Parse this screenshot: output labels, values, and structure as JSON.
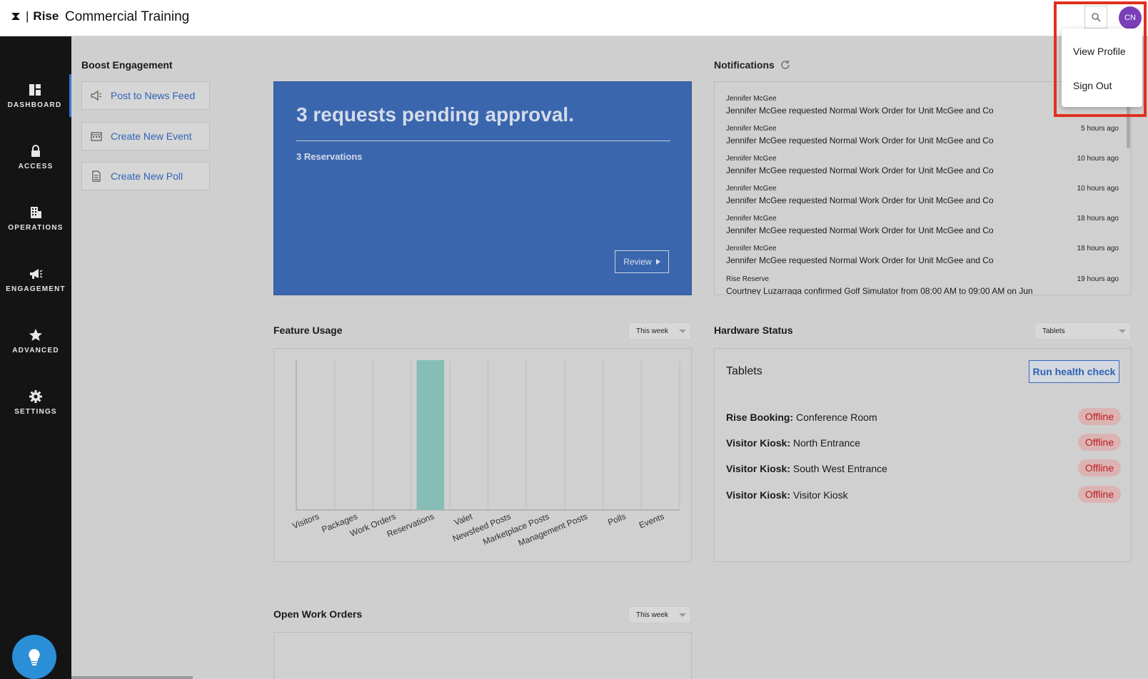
{
  "header": {
    "brand": "Rise",
    "title": "Commercial Training",
    "avatar_initials": "CN",
    "search_icon": "search-icon"
  },
  "sidebar": {
    "items": [
      {
        "label": "DASHBOARD",
        "icon": "dashboard-icon",
        "active": true
      },
      {
        "label": "ACCESS",
        "icon": "lock-icon",
        "active": false
      },
      {
        "label": "OPERATIONS",
        "icon": "building-icon",
        "active": false
      },
      {
        "label": "ENGAGEMENT",
        "icon": "megaphone-icon",
        "active": false
      },
      {
        "label": "ADVANCED",
        "icon": "star-icon",
        "active": false
      },
      {
        "label": "SETTINGS",
        "icon": "gear-icon",
        "active": false
      }
    ],
    "help_icon": "lightbulb-icon"
  },
  "boost": {
    "title": "Boost Engagement",
    "buttons": [
      {
        "label": "Post to News Feed",
        "icon": "megaphone-icon"
      },
      {
        "label": "Create New Event",
        "icon": "calendar-icon"
      },
      {
        "label": "Create New Poll",
        "icon": "document-icon"
      }
    ]
  },
  "pending": {
    "headline": "3 requests pending approval.",
    "subtitle": "3 Reservations",
    "review_label": "Review"
  },
  "notifications": {
    "title": "Notifications",
    "items": [
      {
        "who": "Jennifer McGee",
        "when": "",
        "message": "Jennifer McGee requested Normal Work Order for Unit McGee and Co"
      },
      {
        "who": "Jennifer McGee",
        "when": "5 hours ago",
        "message": "Jennifer McGee requested Normal Work Order for Unit McGee and Co"
      },
      {
        "who": "Jennifer McGee",
        "when": "10 hours ago",
        "message": "Jennifer McGee requested Normal Work Order for Unit McGee and Co"
      },
      {
        "who": "Jennifer McGee",
        "when": "10 hours ago",
        "message": "Jennifer McGee requested Normal Work Order for Unit McGee and Co"
      },
      {
        "who": "Jennifer McGee",
        "when": "18 hours ago",
        "message": "Jennifer McGee requested Normal Work Order for Unit McGee and Co"
      },
      {
        "who": "Jennifer McGee",
        "when": "18 hours ago",
        "message": "Jennifer McGee requested Normal Work Order for Unit McGee and Co"
      },
      {
        "who": "Rise Reserve",
        "when": "19 hours ago",
        "message": "Courtney Luzarraga confirmed Golf Simulator from 08:00 AM to 09:00 AM on Jun"
      }
    ]
  },
  "feature_usage": {
    "title": "Feature Usage",
    "range": "This week"
  },
  "chart_data": {
    "type": "bar",
    "categories": [
      "Visitors",
      "Packages",
      "Work Orders",
      "Reservations",
      "Valet",
      "Newsfeed Posts",
      "Marketplace Posts",
      "Management Posts",
      "Polls",
      "Events"
    ],
    "values": [
      0,
      0,
      0,
      3,
      0,
      0,
      0,
      0,
      0,
      0
    ],
    "ylim": [
      0,
      3
    ],
    "grid": true,
    "bar_color": "#86bdb6"
  },
  "hardware": {
    "title": "Hardware Status",
    "filter": "Tablets",
    "panel_title": "Tablets",
    "health_check_label": "Run health check",
    "devices": [
      {
        "type": "Rise Booking:",
        "name": "Conference Room",
        "status": "Offline"
      },
      {
        "type": "Visitor Kiosk:",
        "name": "North Entrance",
        "status": "Offline"
      },
      {
        "type": "Visitor Kiosk:",
        "name": "South West Entrance",
        "status": "Offline"
      },
      {
        "type": "Visitor Kiosk:",
        "name": "Visitor Kiosk",
        "status": "Offline"
      }
    ]
  },
  "open_work_orders": {
    "title": "Open Work Orders",
    "range": "This week"
  },
  "profile_menu": {
    "items": [
      "View Profile",
      "Sign Out"
    ]
  },
  "colors": {
    "accent": "#3a66ad",
    "offline": "#c01c1c",
    "avatar": "#7a3fb7",
    "highlight": "#e0301e"
  }
}
